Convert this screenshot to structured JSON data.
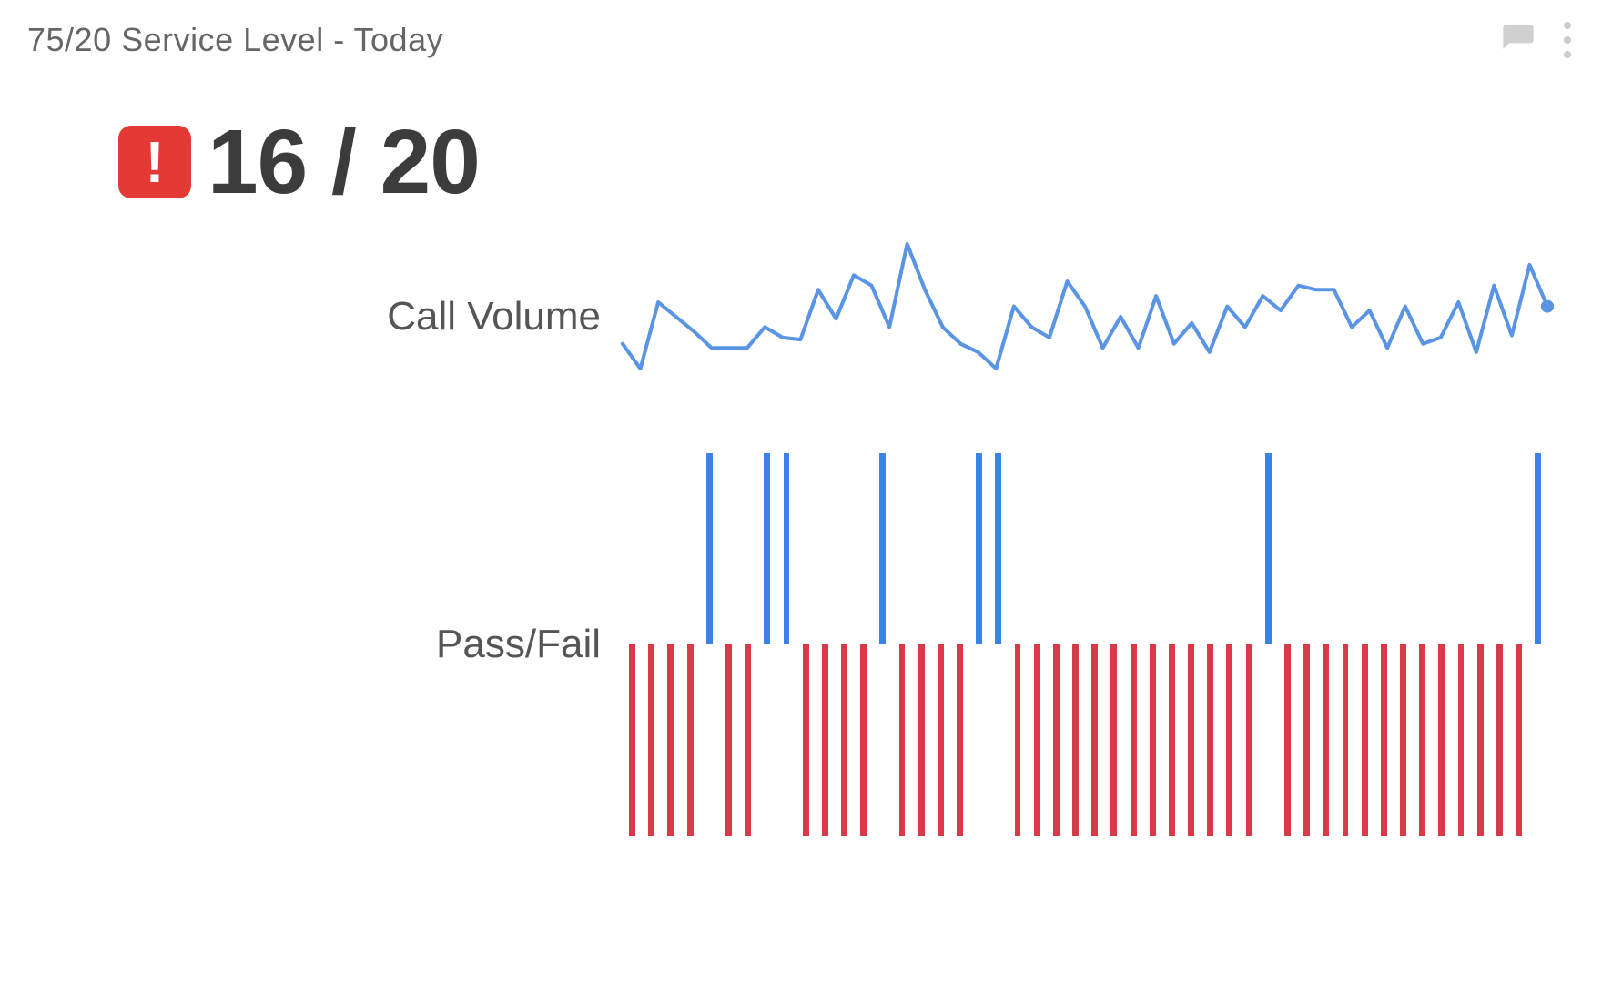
{
  "header": {
    "title": "75/20 Service Level - Today"
  },
  "metric": {
    "alert_symbol": "!",
    "value_text": "16 / 20"
  },
  "labels": {
    "call_volume": "Call Volume",
    "pass_fail": "Pass/Fail"
  },
  "colors": {
    "pass": "#3b82e6",
    "fail": "#d93a4a",
    "line": "#5a94e4",
    "alert_bg": "#e53935"
  },
  "chart_data": [
    {
      "type": "line",
      "title": "Call Volume",
      "xlabel": "",
      "ylabel": "",
      "values": [
        52,
        40,
        72,
        65,
        58,
        50,
        50,
        50,
        60,
        55,
        54,
        78,
        64,
        85,
        80,
        60,
        100,
        78,
        60,
        52,
        48,
        40,
        70,
        60,
        55,
        82,
        70,
        50,
        65,
        50,
        75,
        52,
        62,
        48,
        70,
        60,
        75,
        68,
        80,
        78,
        78,
        60,
        68,
        50,
        70,
        52,
        55,
        72,
        48,
        80,
        56,
        90,
        70
      ],
      "ylim": [
        30,
        100
      ]
    },
    {
      "type": "bar",
      "title": "Pass/Fail",
      "xlabel": "",
      "ylabel": "",
      "categories_note": "one bar per interval; pass=1 (blue up), fail=-1 (red down)",
      "values": [
        -1,
        -1,
        -1,
        -1,
        1,
        -1,
        -1,
        1,
        1,
        -1,
        -1,
        -1,
        -1,
        1,
        -1,
        -1,
        -1,
        -1,
        1,
        1,
        -1,
        -1,
        -1,
        -1,
        -1,
        -1,
        -1,
        -1,
        -1,
        -1,
        -1,
        -1,
        -1,
        1,
        -1,
        -1,
        -1,
        -1,
        -1,
        -1,
        -1,
        -1,
        -1,
        -1,
        -1,
        -1,
        -1,
        1
      ]
    }
  ]
}
